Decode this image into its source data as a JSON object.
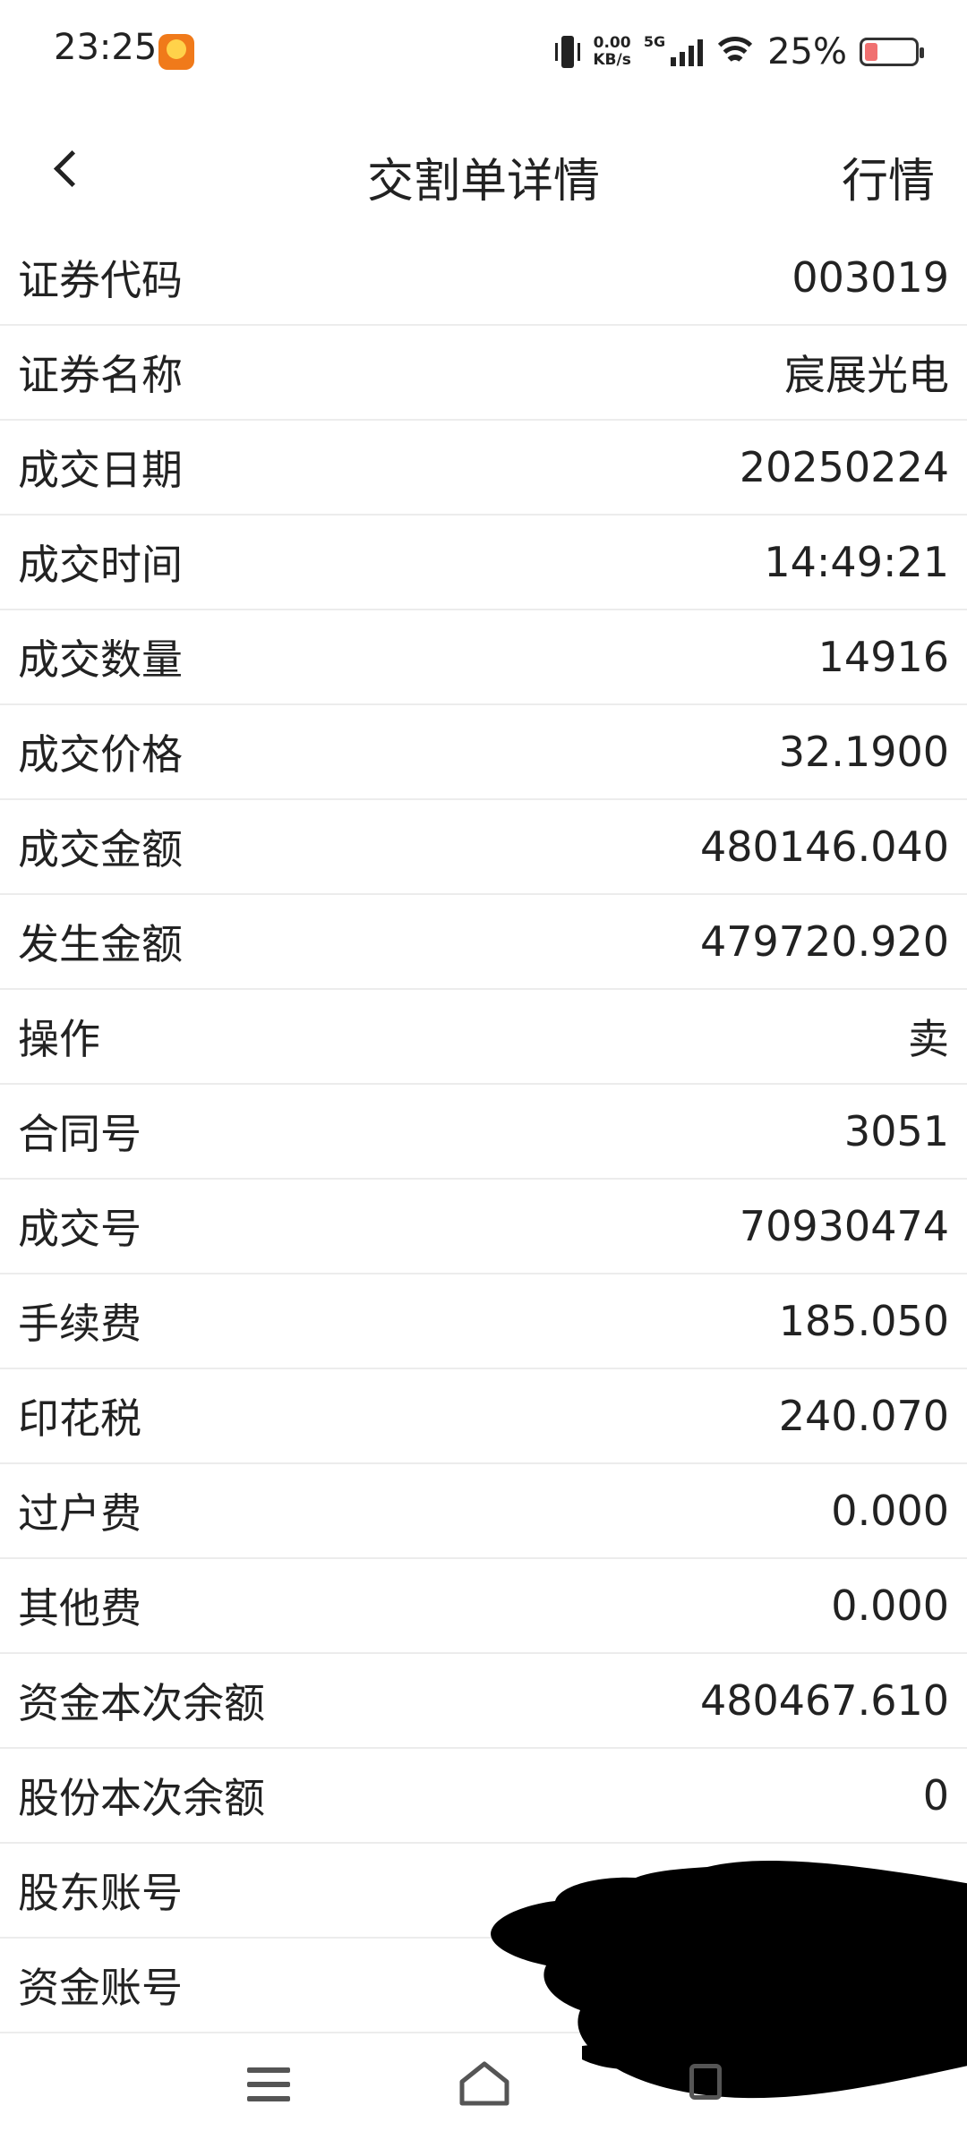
{
  "status_bar": {
    "time": "23:25",
    "net_speed_value": "0.00",
    "net_speed_unit": "KB/s",
    "network_type": "5G",
    "battery_percent": "25%",
    "battery_level": 0.25,
    "icons": [
      "app-notification-icon",
      "vibrate-icon",
      "signal-icon",
      "wifi-icon",
      "battery-icon"
    ]
  },
  "header": {
    "back_icon": "chevron-left-icon",
    "title": "交割单详情",
    "market_link": "行情"
  },
  "details": [
    {
      "label": "证券代码",
      "value": "003019"
    },
    {
      "label": "证券名称",
      "value": "宸展光电"
    },
    {
      "label": "成交日期",
      "value": "20250224"
    },
    {
      "label": "成交时间",
      "value": "14:49:21"
    },
    {
      "label": "成交数量",
      "value": "14916"
    },
    {
      "label": "成交价格",
      "value": "32.1900"
    },
    {
      "label": "成交金额",
      "value": "480146.040"
    },
    {
      "label": "发生金额",
      "value": "479720.920"
    },
    {
      "label": "操作",
      "value": "卖"
    },
    {
      "label": "合同号",
      "value": "3051"
    },
    {
      "label": "成交号",
      "value": "70930474"
    },
    {
      "label": "手续费",
      "value": "185.050"
    },
    {
      "label": "印花税",
      "value": "240.070"
    },
    {
      "label": "过户费",
      "value": "0.000"
    },
    {
      "label": "其他费",
      "value": "0.000"
    },
    {
      "label": "资金本次余额",
      "value": "480467.610"
    },
    {
      "label": "股份本次余额",
      "value": "0"
    },
    {
      "label": "股东账号",
      "value": ""
    },
    {
      "label": "资金账号",
      "value": ""
    }
  ],
  "colors": {
    "text": "#222222",
    "divider": "#ececec",
    "battery_fill": "#f07070",
    "app_icon": "#f07a1a"
  },
  "nav_bar": {
    "icons": [
      "menu-icon",
      "home-icon",
      "recent-apps-icon"
    ]
  }
}
